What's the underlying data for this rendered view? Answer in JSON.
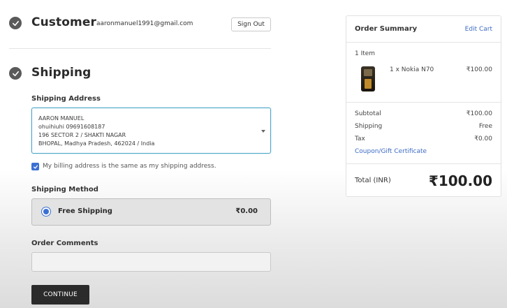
{
  "customer": {
    "title": "Customer",
    "email": "aaronmanuel1991@gmail.com",
    "sign_out": "Sign Out"
  },
  "shipping": {
    "title": "Shipping",
    "address_label": "Shipping Address",
    "address_lines": [
      "AARON MANUEL",
      "ohuihiuhi 09691608187",
      "196 SECTOR 2 / SHAKTI NAGAR",
      "BHOPAL, Madhya Pradesh, 462024 / India"
    ],
    "billing_same_label": "My billing address is the same as my shipping address.",
    "billing_same_checked": true,
    "method_label": "Shipping Method",
    "method_name": "Free Shipping",
    "method_price": "₹0.00",
    "method_selected": true,
    "comments_label": "Order Comments",
    "comments_value": "",
    "continue_label": "CONTINUE"
  },
  "summary": {
    "title": "Order Summary",
    "edit_cart": "Edit Cart",
    "item_count": "1 Item",
    "item_name": "1 x Nokia N70",
    "item_price": "₹100.00",
    "subtotal_label": "Subtotal",
    "subtotal_value": "₹100.00",
    "shipping_label": "Shipping",
    "shipping_value": "Free",
    "tax_label": "Tax",
    "tax_value": "₹0.00",
    "coupon_link": "Coupon/Gift Certificate",
    "total_label": "Total (INR)",
    "total_value": "₹100.00"
  },
  "colors": {
    "accent_blue": "#3b6fd3",
    "focus_border": "#4aa7c9",
    "link": "#3d6bc4",
    "button_dark": "#2b2b2b"
  }
}
